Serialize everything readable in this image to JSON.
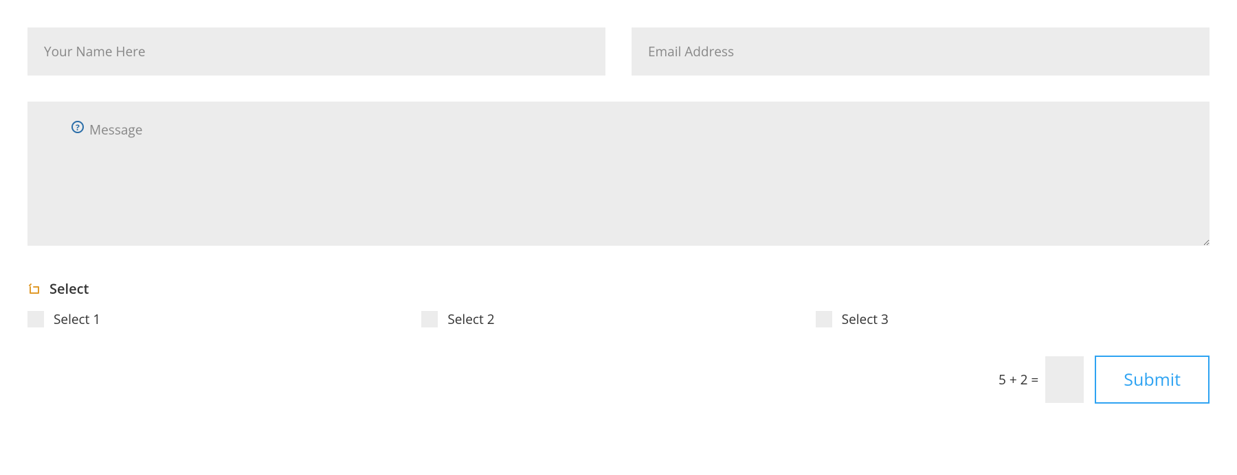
{
  "form": {
    "name_placeholder": "Your Name Here",
    "email_placeholder": "Email Address",
    "message_placeholder": "Message",
    "select": {
      "title": "Select",
      "options": [
        {
          "label": "Select 1"
        },
        {
          "label": "Select 2"
        },
        {
          "label": "Select 3"
        }
      ]
    },
    "captcha": {
      "question": "5 + 2 ="
    },
    "submit_label": "Submit"
  }
}
